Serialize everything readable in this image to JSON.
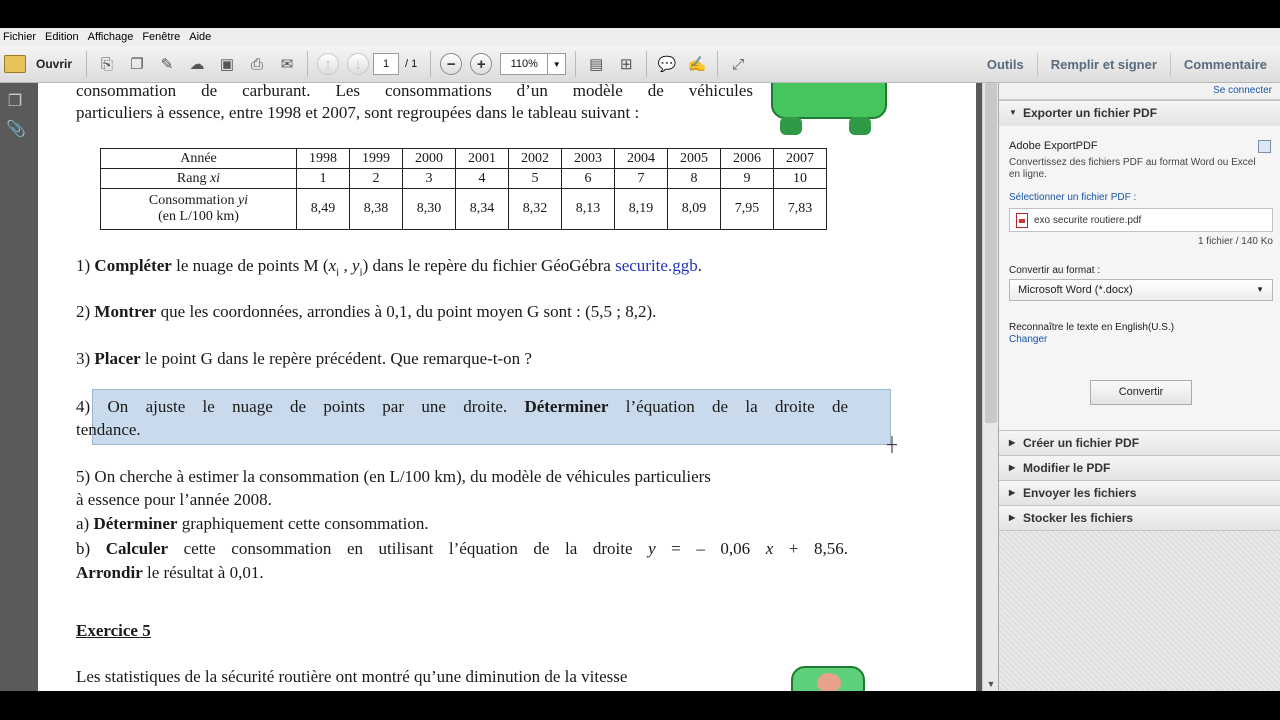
{
  "menu": [
    "Fichier",
    "Edition",
    "Affichage",
    "Fenêtre",
    "Aide"
  ],
  "toolbar": {
    "open_label": "Ouvrir",
    "page_current": "1",
    "page_total": "/ 1",
    "zoom": "110%",
    "tools": "Outils",
    "fill_sign": "Remplir et signer",
    "comment": "Commentaire"
  },
  "document": {
    "intro_line1": "consommation de carburant. Les consommations d’un modèle de véhicules",
    "intro_line2": "particuliers à essence, entre 1998 et 2007, sont regroupées dans le tableau suivant :",
    "table": {
      "row_labels": [
        "Année",
        "Rang",
        "xi",
        "Consommation",
        "yi",
        "(en  L/100 km)"
      ],
      "years": [
        "1998",
        "1999",
        "2000",
        "2001",
        "2002",
        "2003",
        "2004",
        "2005",
        "2006",
        "2007"
      ],
      "ranks": [
        "1",
        "2",
        "3",
        "4",
        "5",
        "6",
        "7",
        "8",
        "9",
        "10"
      ],
      "values": [
        "8,49",
        "8,38",
        "8,30",
        "8,34",
        "8,32",
        "8,13",
        "8,19",
        "8,09",
        "7,95",
        "7,83"
      ]
    },
    "q1": {
      "num": "1) ",
      "bold": "Compléter",
      "text": " le nuage de points M (",
      "x": "x",
      "i1": "i",
      "comma": " , ",
      "y": "y",
      "i2": "i",
      "text2": ") dans le repère du fichier GéoGébra ",
      "link": "securite.ggb",
      "end": "."
    },
    "q2": {
      "num": "2) ",
      "bold": "Montrer",
      "text": " que les coordonnées, arrondies à 0,1, du point moyen G sont : (5,5 ; 8,2)."
    },
    "q3": {
      "num": "3) ",
      "bold": "Placer",
      "text": " le point G dans le repère précédent. Que remarque-t-on ?"
    },
    "q4": {
      "line1_pre": "4)  On ajuste le nuage de points par une droite. ",
      "bold": "Déterminer",
      "line1_post": " l’équation de la droite de",
      "line2": "tendance."
    },
    "q5": {
      "line1": "5) On cherche à estimer la consommation (en L/100 km), du modèle de véhicules particuliers",
      "line2": "à essence pour l’année 2008.",
      "a_num": "a) ",
      "a_bold": "Déterminer",
      "a_text": " graphiquement cette consommation.",
      "b_num": "b)  ",
      "b_bold": "Calculer",
      "b_text": "  cette  consommation  en  utilisant  l’équation  de  la  droite  ",
      "b_eq_y": "y",
      "b_eq_mid": "  =  –  0,06  ",
      "b_eq_x": "x",
      "b_eq_end": "  +  8,56.",
      "c_bold": "Arrondir",
      "c_text": " le résultat à 0,01."
    },
    "ex5_title": "Exercice 5",
    "ex5_line1": "Les statistiques de la sécurité routière ont montré qu’une diminution de la vitesse"
  },
  "right_panel": {
    "connect": "Se connecter",
    "export_title": "Exporter un fichier PDF",
    "adobe_export": "Adobe ExportPDF",
    "export_desc": "Convertissez des fichiers PDF au format Word ou Excel en ligne.",
    "select_pdf": "Sélectionner un fichier PDF :",
    "file_name": "exo securite routiere.pdf",
    "file_info": "1 fichier / 140 Ko",
    "convert_to": "Convertir au format :",
    "format": "Microsoft Word (*.docx)",
    "ocr": "Reconnaître le texte en English(U.S.)",
    "change": "Changer",
    "convert_btn": "Convertir",
    "sections": [
      "Créer un fichier PDF",
      "Modifier le PDF",
      "Envoyer les fichiers",
      "Stocker les fichiers"
    ]
  },
  "colors": {
    "selection": "#9cbcd8",
    "panel_link": "#1a55a4",
    "toolbar_right": "#5a6b7e",
    "car_green": "#46c55e"
  }
}
